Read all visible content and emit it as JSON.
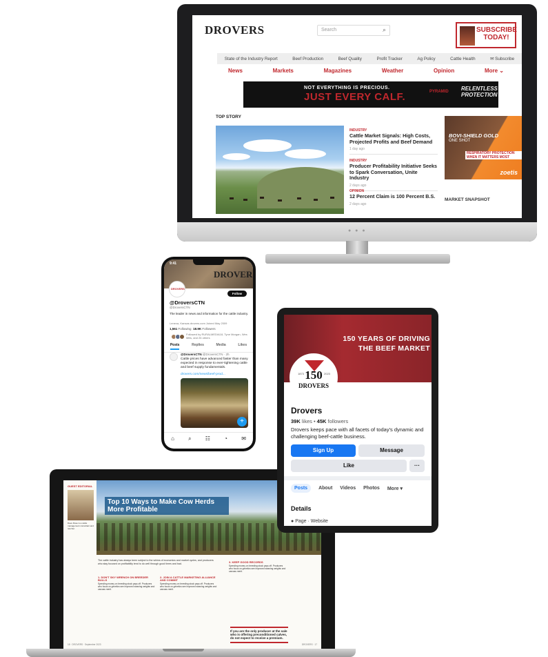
{
  "website": {
    "logo": "DROVERS",
    "search_placeholder": "Search",
    "subscribe": "SUBSCRIBE TODAY!",
    "menu": [
      "State of the Industry Report",
      "Beef Production",
      "Beef Quality",
      "Profit Tracker",
      "Ag Policy",
      "Cattle Health",
      "Subscribe"
    ],
    "nav": [
      "News",
      "Markets",
      "Magazines",
      "Weather",
      "Opinion",
      "More ⌄"
    ],
    "banner": {
      "line1": "NOT EVERYTHING IS PRECIOUS.",
      "line2": "JUST EVERY CALF.",
      "brand": "PYRAMID",
      "slogan": "RELENTLESS PROTECTION"
    },
    "top_story_label": "TOP STORY",
    "stories": [
      {
        "category": "INDUSTRY",
        "headline": "Cattle Market Signals: High Costs, Projected Profits and Beef Demand",
        "time": "1 day ago"
      },
      {
        "category": "INDUSTRY",
        "headline": "Producer Profitability Initiative Seeks to Spark Conversation, Unite Industry",
        "time": "2 days ago"
      },
      {
        "category": "OPINION",
        "headline": "12 Percent Claim is 100 Percent B.S.",
        "time": "2 days ago"
      }
    ],
    "ad": {
      "title": "BOVI-SHIELD GOLD",
      "subtitle": "ONE SHOT",
      "bar": "RESPIRATORY PROTECTION WHEN IT MATTERS MOST",
      "brand": "zoetis"
    },
    "market_snapshot": "MARKET SNAPSHOT"
  },
  "twitter": {
    "time": "9:41",
    "header_logo": "DROVERS",
    "follow": "Follow",
    "name": "@DroversCTN",
    "handle": "@DroversCTN",
    "bio": "The leader in news and information for the cattle industry.",
    "meta": "Lenexa, Kansas  drovers.com  Joined May 2009",
    "following": "1,561",
    "following_label": "Following",
    "followers": "18.9K",
    "followers_label": "Followers",
    "followed_by": "Followed by RURALMEDIA18, Tyne Morgan, Wes Mills, and 26 others",
    "tabs": [
      "Posts",
      "Replies",
      "Media",
      "Likes"
    ],
    "post_name": "@DroversCTN",
    "post_handle": "@DroversCTN · 2h",
    "post_text": "Cattle prices have advanced faster than many expected in response to ever-tightening cattle and beef supply fundamentals.",
    "post_link": "drovers.com/news/beef-prod...",
    "fab": "+",
    "bottom_icons": [
      "home-icon",
      "search-icon",
      "community-icon",
      "bell-icon",
      "mail-icon"
    ]
  },
  "facebook": {
    "cover_text": "150 YEARS OF DRIVING THE BEEF MARKET",
    "logo_number": "150",
    "logo_years": [
      "1873",
      "2023"
    ],
    "logo_brand": "DROVERS",
    "name": "Drovers",
    "likes": "39K",
    "likes_label": "likes",
    "followers": "45K",
    "followers_label": "followers",
    "description": "Drovers keeps pace with all facets of today's dynamic and challenging beef-cattle business.",
    "signup": "Sign Up",
    "message": "Message",
    "like": "Like",
    "more": "···",
    "tabs": [
      "Posts",
      "About",
      "Videos",
      "Photos",
      "More ▾"
    ],
    "details": "Details",
    "page_line": "Page · Website"
  },
  "magazine": {
    "section_tag": "GUEST EDITORIAL",
    "title": "Top 10 Ways to Make Cow Herds More Profitable",
    "author_bio": "Dave Rose is a cattle management consultant and rancher.",
    "intro": "The cattle industry has always been subject to the whims of economics and market cycles, and producers who stay focused on profitability tend to do well through good times and bad.",
    "col_heads": [
      "1. DON'T SKY WRENCH ON BREEDER BULLS",
      "2. JOIN A CATTLE MARKETING ALLIANCE AND COMMIT",
      "3. KEEP GOOD RECORDS"
    ],
    "col_text": "Spending money on breeding stock pays off. Producers who focus on genetics see improved weaning weights and carcass merit.",
    "quote": "If you are the only producer at the sale who is offering preconditioned calves, do not expect to receive a premium.",
    "footer_left": "18 · DROVERS · September 2023",
    "footer_right": "DROVERS · 17"
  }
}
